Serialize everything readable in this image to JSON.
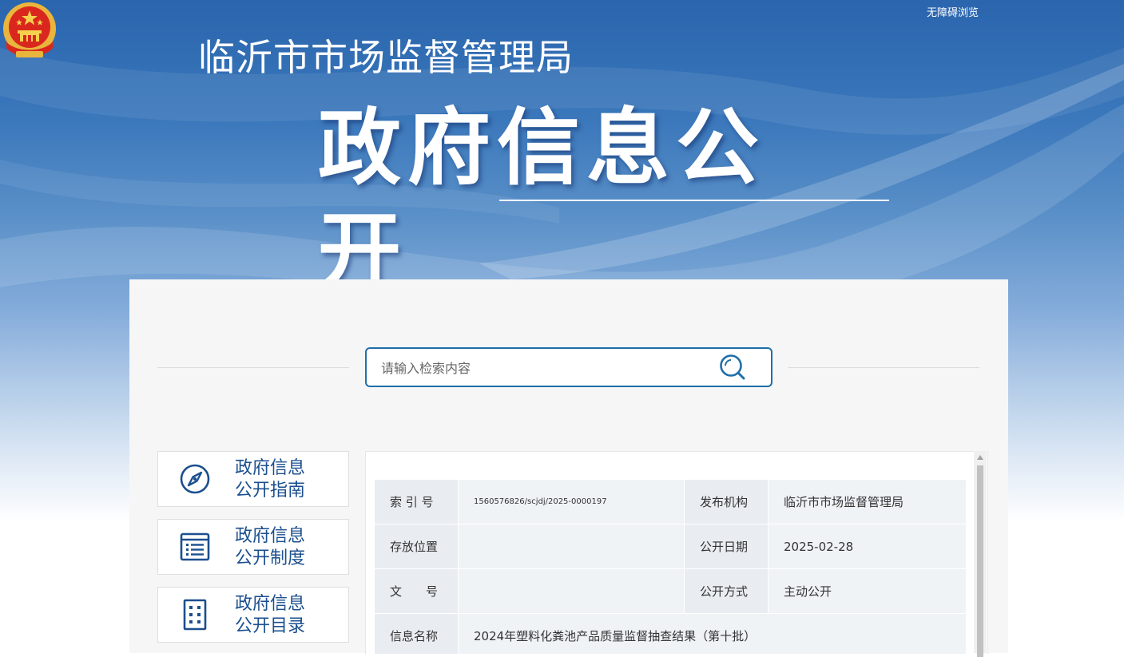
{
  "header": {
    "accessibility_link": "无障碍浏览",
    "agency_name": "临沂市市场监督管理局",
    "banner_title": "政府信息公开"
  },
  "search": {
    "placeholder": "请输入检索内容",
    "icon": "search-icon"
  },
  "sidebar": {
    "items": [
      {
        "line1": "政府信息",
        "line2": "公开指南",
        "icon": "compass-icon"
      },
      {
        "line1": "政府信息",
        "line2": "公开制度",
        "icon": "document-list-icon"
      },
      {
        "line1": "政府信息",
        "line2": "公开目录",
        "icon": "catalog-grid-icon"
      }
    ]
  },
  "meta_table": {
    "rows": [
      {
        "k1": "索 引 号",
        "v1": "1560576826/scjdj/2025-0000197",
        "k2": "发布机构",
        "v2": "临沂市市场监督管理局"
      },
      {
        "k1": "存放位置",
        "v1": "",
        "k2": "公开日期",
        "v2": "2025-02-28"
      },
      {
        "k1": "文　　号",
        "v1": "",
        "k2": "公开方式",
        "v2": "主动公开"
      },
      {
        "k1": "信息名称",
        "v1": "2024年塑料化粪池产品质量监督抽查结果（第十批）"
      }
    ]
  },
  "colors": {
    "brand_blue": "#2a65ad",
    "link_blue": "#1b4f8e",
    "search_border": "#1f6fa9",
    "panel_bg": "#f6f6f6"
  }
}
